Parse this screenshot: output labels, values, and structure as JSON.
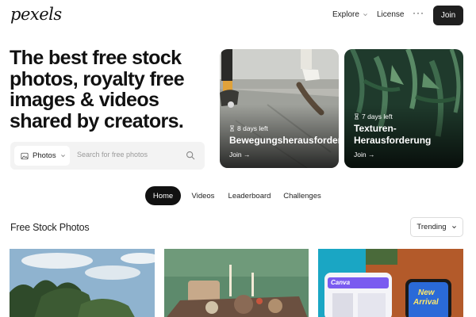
{
  "header": {
    "logo": "pexels",
    "explore": "Explore",
    "license": "License",
    "more": "···",
    "join": "Join"
  },
  "hero": {
    "title": "The best free stock photos, royalty free images & videos shared by creators."
  },
  "search": {
    "media_type": "Photos",
    "placeholder": "Search for free photos"
  },
  "challenges": [
    {
      "days_left": "8 days left",
      "title": "Bewegungsherausforderung",
      "join": "Join →"
    },
    {
      "days_left": "7 days left",
      "title_line1": "Texturen-",
      "title_line2": "Herausforderung",
      "join": "Join →"
    }
  ],
  "tabs": [
    {
      "label": "Home",
      "active": true
    },
    {
      "label": "Videos",
      "active": false
    },
    {
      "label": "Leaderboard",
      "active": false
    },
    {
      "label": "Challenges",
      "active": false
    }
  ],
  "section": {
    "title": "Free Stock Photos",
    "sort": "Trending"
  },
  "photo3": {
    "app_label": "Canva",
    "sign_line1": "New",
    "sign_line2": "Arrival"
  },
  "colors": {
    "join_button": "#1f1f1f",
    "active_tab": "#111111"
  }
}
